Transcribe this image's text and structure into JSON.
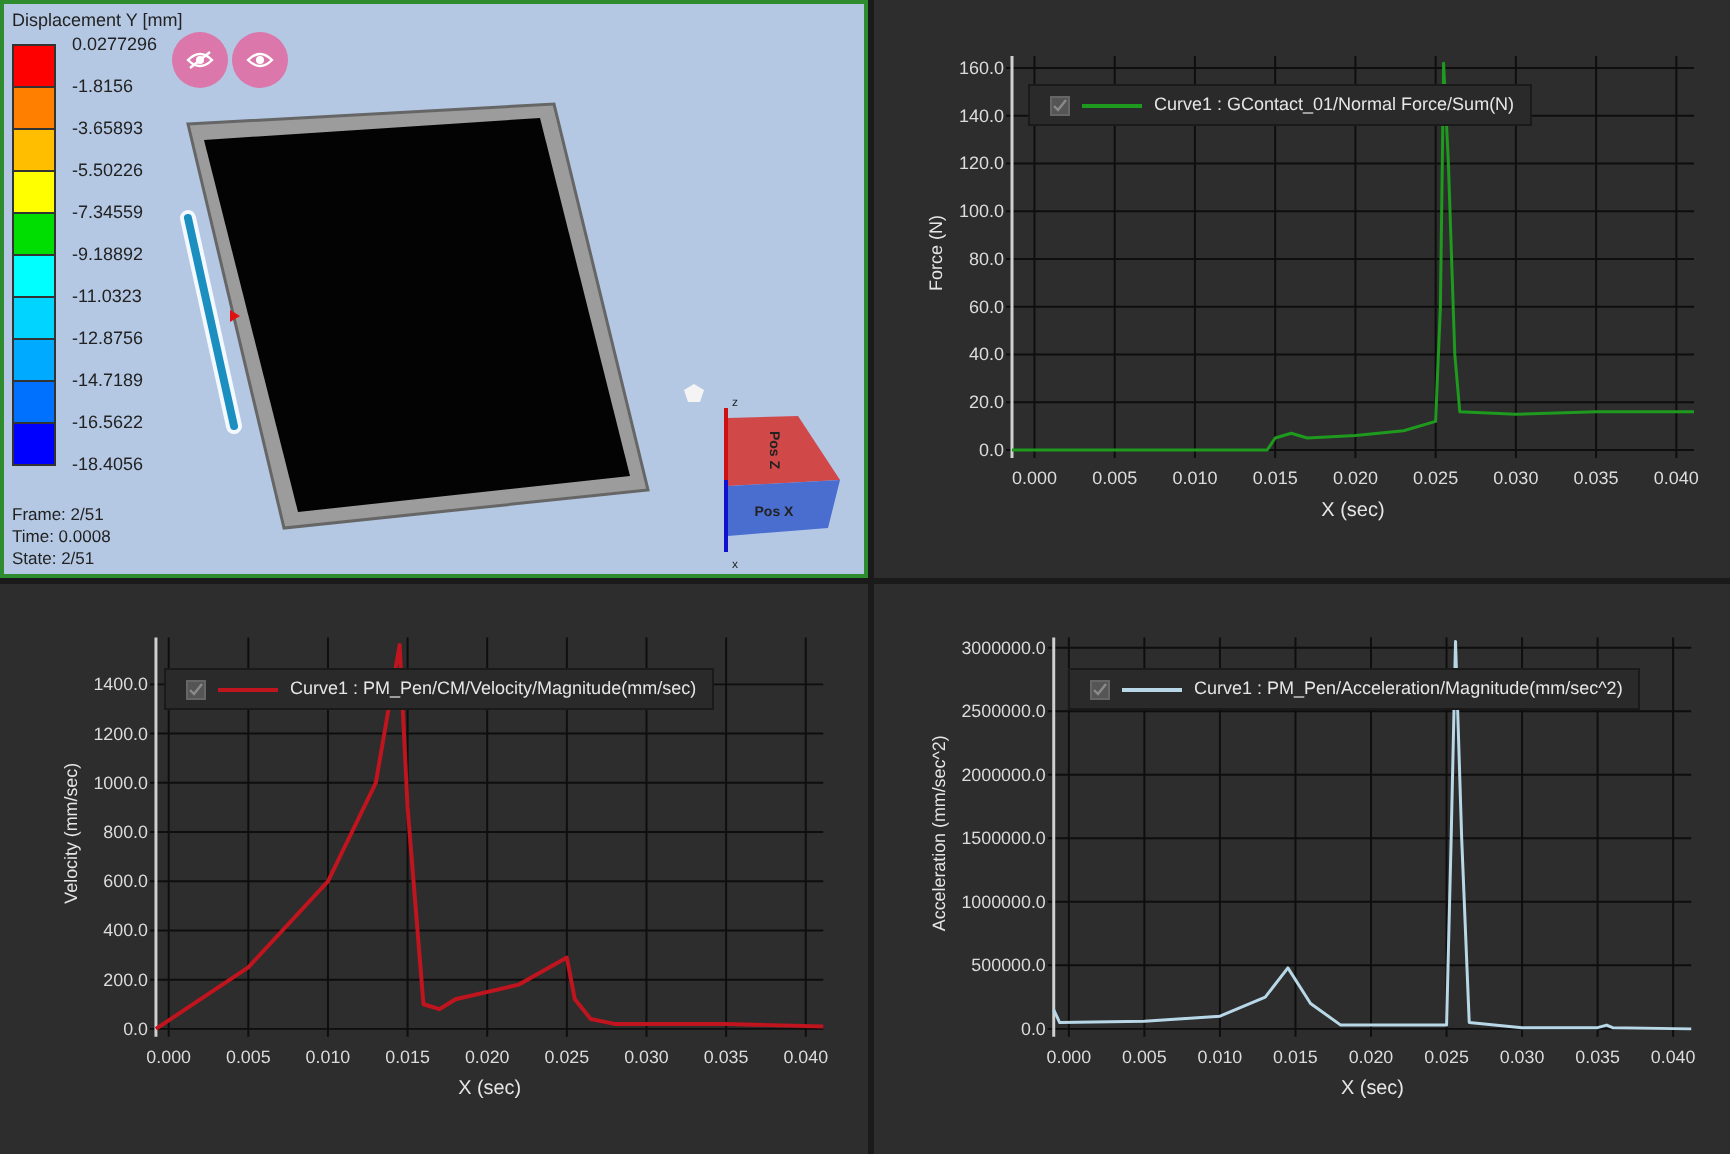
{
  "viewport": {
    "colorbar": {
      "title": "Displacement Y [mm]",
      "bands": [
        {
          "color": "#ff0000"
        },
        {
          "color": "#ff7f00"
        },
        {
          "color": "#ffbf00"
        },
        {
          "color": "#ffff00"
        },
        {
          "color": "#00dd00"
        },
        {
          "color": "#00ffff"
        },
        {
          "color": "#00d4ff"
        },
        {
          "color": "#00aaff"
        },
        {
          "color": "#0070ff"
        },
        {
          "color": "#0000ff"
        }
      ],
      "labels": [
        "0.0277296",
        "-1.8156",
        "-3.65893",
        "-5.50226",
        "-7.34559",
        "-9.18892",
        "-11.0323",
        "-12.8756",
        "-14.7189",
        "-16.5622",
        "-18.4056"
      ]
    },
    "info": [
      "Frame: 2/51",
      "Time: 0.0008",
      "State: 2/51"
    ],
    "view_cube": {
      "faces": [
        "Pos Z",
        "Pos X"
      ],
      "axes": [
        "z",
        "x"
      ]
    }
  },
  "plots": [
    {
      "legend": {
        "checked": true
      },
      "chart_data": {
        "type": "line",
        "grid": true,
        "xlabel": "X (sec)",
        "ylabel": "Force (N)",
        "xlim": [
          -0.0014,
          0.0411
        ],
        "ylim": [
          0,
          165
        ],
        "xticks": [
          {
            "value": 0,
            "label": "0.000"
          },
          {
            "value": 0.005,
            "label": "0.005"
          },
          {
            "value": 0.01,
            "label": "0.010"
          },
          {
            "value": 0.015,
            "label": "0.015"
          },
          {
            "value": 0.02,
            "label": "0.020"
          },
          {
            "value": 0.025,
            "label": "0.025"
          },
          {
            "value": 0.03,
            "label": "0.030"
          },
          {
            "value": 0.035,
            "label": "0.035"
          },
          {
            "value": 0.04,
            "label": "0.040"
          }
        ],
        "yticks": [
          {
            "value": 0,
            "label": "0.0"
          },
          {
            "value": 20,
            "label": "20.0"
          },
          {
            "value": 40,
            "label": "40.0"
          },
          {
            "value": 60,
            "label": "60.0"
          },
          {
            "value": 80,
            "label": "80.0"
          },
          {
            "value": 100,
            "label": "100.0"
          },
          {
            "value": 120,
            "label": "120.0"
          },
          {
            "value": 140,
            "label": "140.0"
          },
          {
            "value": 160,
            "label": "160.0"
          }
        ],
        "x": [
          -0.0014,
          0.0145,
          0.015,
          0.016,
          0.017,
          0.02,
          0.023,
          0.025,
          0.0253,
          0.0255,
          0.0258,
          0.0262,
          0.0265,
          0.03,
          0.035,
          0.0411
        ],
        "series": [
          {
            "name": "Curve1 : GContact_01/Normal Force/Sum(N)",
            "color": "#1e9a1e",
            "values": [
              0,
              0,
              5,
              7,
              5,
              6,
              8,
              12,
              60,
              162,
              120,
              40,
              16,
              15,
              16,
              16
            ]
          }
        ]
      }
    },
    {
      "legend": {
        "checked": true
      },
      "chart_data": {
        "type": "line",
        "grid": true,
        "xlabel": "X (sec)",
        "ylabel": "Velocity (mm/sec)",
        "xlim": [
          -0.0008,
          0.0411
        ],
        "ylim": [
          0,
          1590
        ],
        "xticks": [
          {
            "value": 0,
            "label": "0.000"
          },
          {
            "value": 0.005,
            "label": "0.005"
          },
          {
            "value": 0.01,
            "label": "0.010"
          },
          {
            "value": 0.015,
            "label": "0.015"
          },
          {
            "value": 0.02,
            "label": "0.020"
          },
          {
            "value": 0.025,
            "label": "0.025"
          },
          {
            "value": 0.03,
            "label": "0.030"
          },
          {
            "value": 0.035,
            "label": "0.035"
          },
          {
            "value": 0.04,
            "label": "0.040"
          }
        ],
        "yticks": [
          {
            "value": 0,
            "label": "0.0"
          },
          {
            "value": 200,
            "label": "200.0"
          },
          {
            "value": 400,
            "label": "400.0"
          },
          {
            "value": 600,
            "label": "600.0"
          },
          {
            "value": 800,
            "label": "800.0"
          },
          {
            "value": 1000,
            "label": "1000.0"
          },
          {
            "value": 1200,
            "label": "1200.0"
          },
          {
            "value": 1400,
            "label": "1400.0"
          }
        ],
        "x": [
          -0.0008,
          0.005,
          0.01,
          0.013,
          0.0145,
          0.015,
          0.016,
          0.017,
          0.018,
          0.022,
          0.025,
          0.0255,
          0.0265,
          0.028,
          0.035,
          0.0411
        ],
        "series": [
          {
            "name": "Curve1 : PM_Pen/CM/Velocity/Magnitude(mm/sec)",
            "color": "#c0141e",
            "values": [
              0,
              250,
              600,
              1000,
              1560,
              900,
              100,
              80,
              120,
              180,
              290,
              120,
              40,
              20,
              20,
              10
            ]
          }
        ]
      }
    },
    {
      "legend": {
        "checked": true
      },
      "chart_data": {
        "type": "line",
        "grid": true,
        "xlabel": "X (sec)",
        "ylabel": "Acceleration (mm/sec^2)",
        "xlim": [
          -0.001,
          0.0412
        ],
        "ylim": [
          0,
          3080000
        ],
        "xticks": [
          {
            "value": 0,
            "label": "0.000"
          },
          {
            "value": 0.005,
            "label": "0.005"
          },
          {
            "value": 0.01,
            "label": "0.010"
          },
          {
            "value": 0.015,
            "label": "0.015"
          },
          {
            "value": 0.02,
            "label": "0.020"
          },
          {
            "value": 0.025,
            "label": "0.025"
          },
          {
            "value": 0.03,
            "label": "0.030"
          },
          {
            "value": 0.035,
            "label": "0.035"
          },
          {
            "value": 0.04,
            "label": "0.040"
          }
        ],
        "yticks": [
          {
            "value": 0,
            "label": "0.0"
          },
          {
            "value": 500000,
            "label": "500000.0"
          },
          {
            "value": 1000000,
            "label": "1000000.0"
          },
          {
            "value": 1500000,
            "label": "1500000.0"
          },
          {
            "value": 2000000,
            "label": "2000000.0"
          },
          {
            "value": 2500000,
            "label": "2500000.0"
          },
          {
            "value": 3000000,
            "label": "3000000.0"
          }
        ],
        "x": [
          -0.001,
          -0.0006,
          0.005,
          0.01,
          0.013,
          0.0145,
          0.016,
          0.018,
          0.025,
          0.0253,
          0.0256,
          0.026,
          0.0265,
          0.03,
          0.035,
          0.0356,
          0.036,
          0.0412
        ],
        "series": [
          {
            "name": "Curve1 : PM_Pen/Acceleration/Magnitude(mm/sec^2)",
            "color": "#b8d8e8",
            "values": [
              150000,
              50000,
              60000,
              100000,
              250000,
              480000,
              200000,
              30000,
              30000,
              1500000,
              3050000,
              1500000,
              50000,
              10000,
              10000,
              30000,
              10000,
              0
            ]
          }
        ]
      }
    }
  ]
}
